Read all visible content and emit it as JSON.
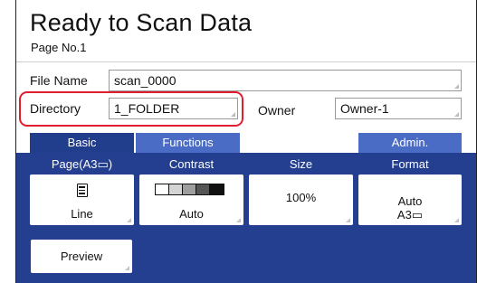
{
  "header": {
    "title": "Ready to Scan Data",
    "page_label": "Page No.1"
  },
  "form": {
    "file_name_label": "File Name",
    "file_name_value": "scan_0000",
    "directory_label": "Directory",
    "directory_value": "1_FOLDER",
    "owner_label": "Owner",
    "owner_value": "Owner-1"
  },
  "tabs": [
    {
      "label": "Basic"
    },
    {
      "label": "Functions"
    },
    {
      "label": "Admin."
    }
  ],
  "columns": {
    "page": "Page(A3▭)",
    "contrast": "Contrast",
    "size": "Size",
    "format": "Format"
  },
  "cards": {
    "page_value": "Line",
    "contrast_value": "Auto",
    "size_value": "100%",
    "format_line1": "Auto",
    "format_line2": "A3▭"
  },
  "preview_label": "Preview",
  "colors": {
    "panel": "#243f90",
    "tab": "#3a5bb0",
    "highlight": "#e21d2f"
  },
  "icons": {
    "page": "document-lines-icon",
    "contrast": "contrast-scale-icon"
  }
}
